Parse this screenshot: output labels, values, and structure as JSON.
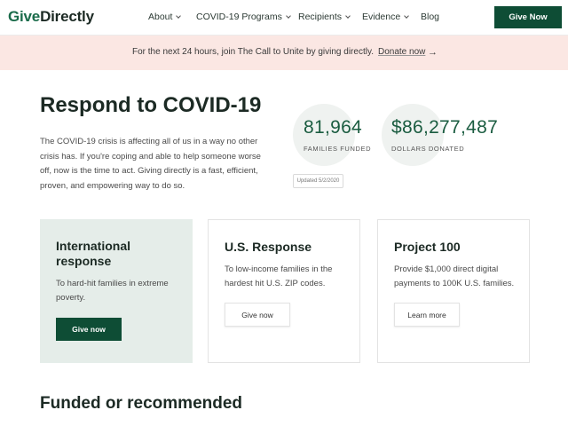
{
  "header": {
    "logo_give": "Give",
    "logo_directly": "Directly",
    "nav": [
      {
        "label": "About",
        "has_dropdown": true
      },
      {
        "label": "COVID-19 Programs",
        "has_dropdown": true
      },
      {
        "label": "Recipients",
        "has_dropdown": true
      },
      {
        "label": "Evidence",
        "has_dropdown": true
      },
      {
        "label": "Blog",
        "has_dropdown": false
      }
    ],
    "cta_label": "Give Now"
  },
  "banner": {
    "text": "For the next 24 hours, join The Call to Unite by giving directly.",
    "link_label": "Donate now",
    "arrow_icon": "arrow-right-icon"
  },
  "hero": {
    "title": "Respond to COVID-19",
    "description": "The COVID-19 crisis is affecting all of us in a way no other crisis has. If you're coping and able to help someone worse off, now is the time to act. Giving directly is a fast, efficient, proven, and empowering way to do so.",
    "stats": [
      {
        "value": "81,964",
        "label": "FAMILIES FUNDED"
      },
      {
        "value": "$86,277,487",
        "label": "DOLLARS DONATED"
      }
    ],
    "updated": "Updated 5/2/2020"
  },
  "cards": [
    {
      "title": "International response",
      "description": "To hard-hit families in extreme poverty.",
      "button_label": "Give now",
      "style": "solid"
    },
    {
      "title": "U.S. Response",
      "description": "To low-income families in the hardest hit U.S. ZIP codes.",
      "button_label": "Give now",
      "style": "outline"
    },
    {
      "title": "Project 100",
      "description": "Provide $1,000 direct digital payments to 100K U.S. families.",
      "button_label": "Learn more",
      "style": "outline"
    }
  ],
  "section": {
    "title": "Funded or recommended"
  },
  "colors": {
    "brand_green": "#0e4d35",
    "stat_green": "#1a5c40",
    "banner_bg": "#fbe7e3",
    "card_green_bg": "#e5ede9"
  }
}
